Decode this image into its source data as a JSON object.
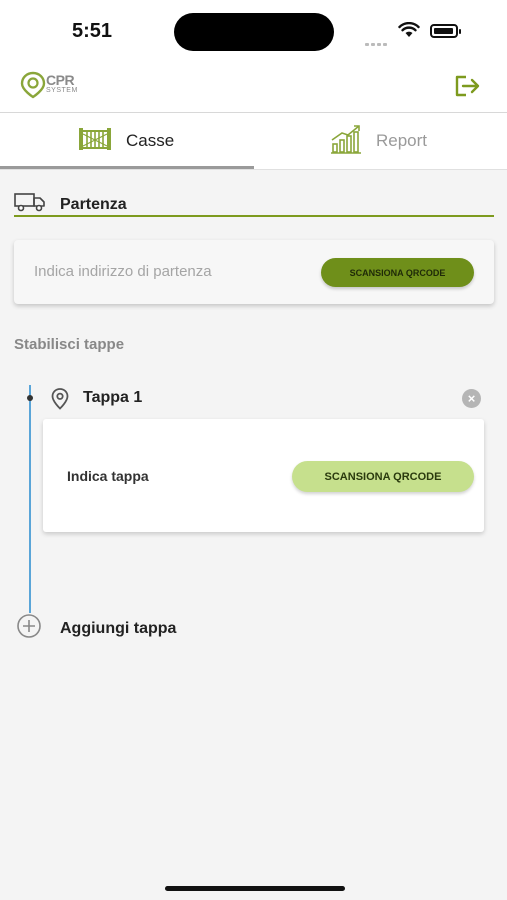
{
  "status_bar": {
    "time": "5:51"
  },
  "app": {
    "logo_main": "CPR",
    "logo_sub": "SYSTEM",
    "accent": "#7d9a1e"
  },
  "tabs": [
    {
      "label": "Casse",
      "active": true,
      "icon": "gate-icon"
    },
    {
      "label": "Report",
      "active": false,
      "icon": "chart-growth-icon"
    }
  ],
  "partenza": {
    "label": "Partenza",
    "placeholder": "Indica indirizzo di partenza",
    "scan_button": "SCANSIONA QRCODE"
  },
  "stops": {
    "section_label": "Stabilisci tappe",
    "items": [
      {
        "title": "Tappa 1",
        "prompt": "Indica tappa",
        "scan_button": "SCANSIONA QRCODE"
      }
    ],
    "add_label": "Aggiungi tappa"
  }
}
